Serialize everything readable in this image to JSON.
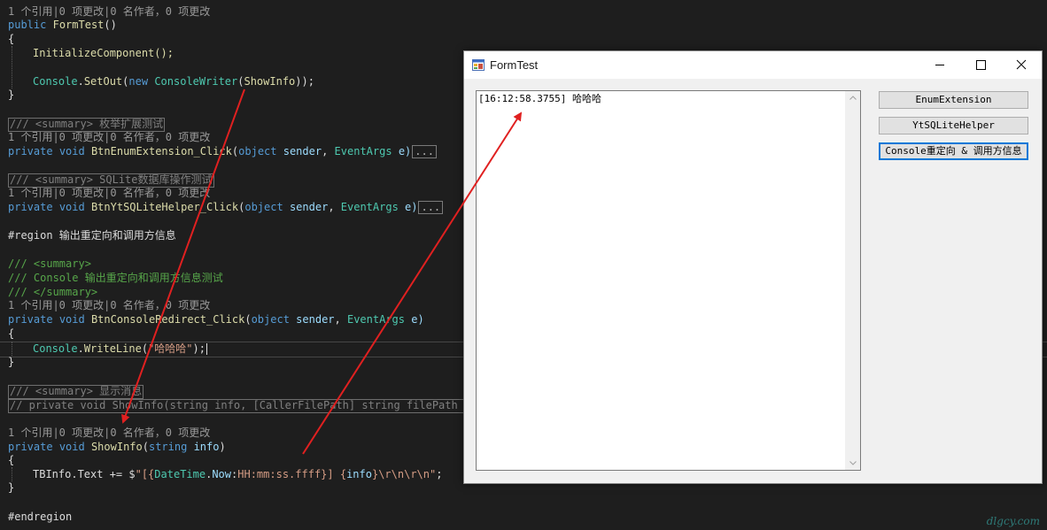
{
  "editor": {
    "lines": {
      "l1": "1 个引用|0 项更改|0 名作者，0 项更改",
      "l2_kw": "public",
      "l2_name": "FormTest",
      "l2_rest": "()",
      "l3": "{",
      "l4": "InitializeComponent();",
      "l5_a": "Console",
      "l5_b": ".",
      "l5_c": "SetOut",
      "l5_d": "(",
      "l5_e": "new",
      "l5_f": "ConsoleWriter",
      "l5_g": "(",
      "l5_h": "ShowInfo",
      "l5_i": "));",
      "l6": "}",
      "l7": "/// <summary> 枚举扩展测试",
      "l8": "1 个引用|0 项更改|0 名作者，0 项更改",
      "l9_kw": "private",
      "l9_void": "void",
      "l9_name": "BtnEnumExtension_Click",
      "l9_p1": "(",
      "l9_obj": "object",
      "l9_sender": "sender",
      "l9_comma": ", ",
      "l9_args": "EventArgs",
      "l9_e": "e)",
      "l9_ell": "...",
      "l10": "/// <summary> SQLite数据库操作测试",
      "l11": "1 个引用|0 项更改|0 名作者，0 项更改",
      "l12_kw": "private",
      "l12_void": "void",
      "l12_name": "BtnYtSQLiteHelper_Click",
      "l12_p1": "(",
      "l12_obj": "object",
      "l12_sender": "sender",
      "l12_comma": ", ",
      "l12_args": "EventArgs",
      "l12_e": "e)",
      "l12_ell": "...",
      "l13": "#region 输出重定向和调用方信息",
      "l14": "/// <summary>",
      "l15": "/// Console 输出重定向和调用方信息测试",
      "l16": "/// </summary>",
      "l17": "1 个引用|0 项更改|0 名作者，0 项更改",
      "l18_kw": "private",
      "l18_void": "void",
      "l18_name": "BtnConsoleRedirect_Click",
      "l18_p1": "(",
      "l18_obj": "object",
      "l18_sender": "sender",
      "l18_comma": ", ",
      "l18_args": "EventArgs",
      "l18_e": "e)",
      "l19": "{",
      "l20_a": "Console",
      "l20_b": ".",
      "l20_c": "WriteLine",
      "l20_d": "(",
      "l20_str": "\"哈哈哈\"",
      "l20_e": ");",
      "l21": "}",
      "l22": "/// <summary> 显示消息",
      "l23": "// private void ShowInfo(string info, [CallerFilePath] string filePath = ",
      "l24": "1 个引用|0 项更改|0 名作者，0 项更改",
      "l25_kw": "private",
      "l25_void": "void",
      "l25_name": "ShowInfo",
      "l25_p1": "(",
      "l25_str": "string",
      "l25_info": "info",
      "l25_e": ")",
      "l26": "{",
      "l27_a": "TBInfo",
      "l27_b": ".Text += $",
      "l27_c": "\"[{",
      "l27_d": "DateTime",
      "l27_e": ".",
      "l27_f": "Now",
      "l27_g": ":",
      "l27_h": "HH:mm:ss.ffff",
      "l27_i": "}] {",
      "l27_j": "info",
      "l27_k": "}\\r\\n\\r\\n\"",
      "l27_l": ";",
      "l28": "}",
      "l29": "#endregion"
    }
  },
  "window": {
    "title": "FormTest",
    "textbox_content": "[16:12:58.3755] 哈哈哈",
    "buttons": {
      "enum": "EnumExtension",
      "sqlite": "YtSQLiteHelper",
      "console": "Console重定向 & 调用方信息"
    }
  },
  "watermark": "dlgcy.com",
  "colors": {
    "editor_bg": "#1e1e1e",
    "keyword": "#569cd6",
    "type": "#4ec9b0",
    "method": "#dcdcaa",
    "comment": "#57a64a",
    "string": "#d69d85",
    "arrow": "#e02020",
    "focus": "#0078d7"
  }
}
